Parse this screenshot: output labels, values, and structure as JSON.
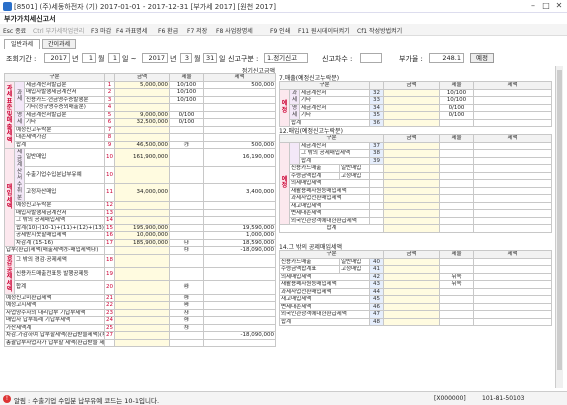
{
  "window": {
    "title": "[8501] (주)세동하전자 (기) 2017-01-01 - 2017-12-31 [부가세 2017] [원천 2017]"
  },
  "app": {
    "title": "부가가치세신고서"
  },
  "toolbar": [
    "Esc 종료",
    "Ctrl 부가세작업관리",
    "F3 마감",
    "F4 과표명세",
    "F6 환급",
    "F7 저장",
    "F8 사업장명세",
    "F9 인쇄",
    "F11 원시데이터켜기",
    "Cf1 작성방법켜기"
  ],
  "tabs": [
    "일반과세",
    "간이과세"
  ],
  "filter": {
    "label_period": "조회기간 :",
    "year1": "2017",
    "unit_year": "년",
    "month1": "1",
    "unit_month": "월",
    "day1": "1",
    "unit_day": "일 ~",
    "year2": "2017",
    "month2": "3",
    "day2": "31",
    "label_type": "신고구분 :",
    "type_val": "1.정기신고",
    "label_seq": "신고차수 :",
    "label_rate": "부가율 :",
    "rate_val": "248.1",
    "btn": "예정"
  },
  "left": {
    "period_hdr": "정기신고금액",
    "hdr": [
      "구분",
      "",
      "금액",
      "세율",
      "세액"
    ],
    "rows": [
      [
        "세금계산서발급분",
        "1",
        "5,000,000",
        "10/100",
        "500,000"
      ],
      [
        "매입자발행세금계산서",
        "2",
        "",
        "10/100",
        ""
      ],
      [
        "신용카드·현금영수증발행분",
        "3",
        "",
        "10/100",
        ""
      ],
      [
        "기타(정규영수증외매출분)",
        "4",
        "",
        "",
        ""
      ],
      [
        "세금계산서발급분",
        "5",
        "9,000,000",
        "0/100",
        ""
      ],
      [
        "기타",
        "6",
        "32,500,000",
        "0/100",
        ""
      ],
      [
        "예정신고누락분",
        "7",
        "",
        "",
        ""
      ],
      [
        "대손세액가감",
        "8",
        "",
        "",
        ""
      ],
      [
        "합계",
        "9",
        "46,500,000",
        "㉮",
        "500,000"
      ],
      [
        "일반매입",
        "10",
        "161,900,000",
        "",
        "16,190,000"
      ],
      [
        "수출기업수입분납부유예",
        "10",
        "",
        "",
        ""
      ],
      [
        "고정자산매입",
        "11",
        "34,000,000",
        "",
        "3,400,000"
      ],
      [
        "예정신고누락분",
        "12",
        "",
        "",
        ""
      ],
      [
        "매입자발행세금계산서",
        "13",
        "",
        "",
        ""
      ],
      [
        "그 밖의 공제매입세액",
        "14",
        "",
        "",
        ""
      ],
      [
        "합계(10)-(10-1)+(11)+(12)+(13)+(14)",
        "15",
        "195,900,000",
        "",
        "19,590,000"
      ],
      [
        "공제받지못할매입세액",
        "16",
        "10,000,000",
        "",
        "1,000,000"
      ],
      [
        "차감계 (15-16)",
        "17",
        "185,900,000",
        "㉯",
        "18,590,000"
      ],
      [
        "납부(환급)세액(매출세액㉮-매입세액㉯)",
        "",
        "",
        "㉰",
        "-18,090,000"
      ],
      [
        "그 밖의 경감·공제세액",
        "18",
        "",
        "",
        ""
      ],
      [
        "신용카드매출전표등 발행공제등",
        "19",
        "",
        "",
        ""
      ],
      [
        "합계",
        "20",
        "",
        "㉱",
        ""
      ],
      [
        "예정신고미환급세액",
        "21",
        "",
        "㉲",
        ""
      ],
      [
        "예정고지세액",
        "22",
        "",
        "㉳",
        ""
      ],
      [
        "사업양수자의 대리납부 기납부세액",
        "23",
        "",
        "㉴",
        ""
      ],
      [
        "매입자 납부특례 기납부세액",
        "24",
        "",
        "㉵",
        ""
      ],
      [
        "가산세액계",
        "25",
        "",
        "㉶",
        ""
      ],
      [
        "차감.가감하여 납부할세액(환급받을세액)(㉰-㉱-㉲-㉳-㉴-㉵+㉶)",
        "27",
        "",
        "",
        "-18,090,000"
      ],
      [
        "총괄납부사업자가 납부할 세액(환급받을 세액)",
        "",
        "",
        "",
        ""
      ]
    ],
    "side": {
      "tax": "과세",
      "zero": "영세",
      "sales_tax": "과세표준및매출세액",
      "purchase": "매입세액",
      "tax_invoice_recv": "세금계산서수취분",
      "reduce": "경감공제세액",
      "etc": "기타"
    }
  },
  "right": {
    "sec7": "7.매출(예정신고누락분)",
    "sec7_rows": [
      [
        "세금계산서",
        "32",
        "",
        "10/100",
        ""
      ],
      [
        "기타",
        "33",
        "",
        "10/100",
        ""
      ],
      [
        "세금계산서",
        "34",
        "",
        "0/100",
        ""
      ],
      [
        "기타",
        "35",
        "",
        "0/100",
        ""
      ],
      [
        "합계",
        "36",
        "",
        "",
        ""
      ]
    ],
    "sec12": "12.매입(예정신고누락분)",
    "sec12_rows": [
      [
        "세금계산서",
        "37",
        "",
        "",
        ""
      ],
      [
        "그 밖의 공제매입세액",
        "38",
        "",
        "",
        ""
      ],
      [
        "합계",
        "39",
        "",
        "",
        ""
      ],
      [
        "신용카드매출",
        "",
        "일반매입",
        "",
        ""
      ],
      [
        "수령금액합계",
        "",
        "고정매입",
        "",
        ""
      ],
      [
        "의제매입세액",
        "",
        "",
        "",
        ""
      ],
      [
        "재활용폐자원등매입세액",
        "",
        "",
        "",
        ""
      ],
      [
        "과세사업전환매입세액",
        "",
        "",
        "",
        ""
      ],
      [
        "재고매입세액",
        "",
        "",
        "",
        ""
      ],
      [
        "변제대손세액",
        "",
        "",
        "",
        ""
      ],
      [
        "외국인관광객에대한환급세액",
        "",
        "",
        "",
        ""
      ],
      [
        "합계",
        "",
        "",
        "",
        ""
      ]
    ],
    "sec14": "14.그 밖의 공제매입세액",
    "sec14_rows": [
      [
        "신용카드매출",
        "일반매입",
        "40",
        "",
        ""
      ],
      [
        "수령금액합계표",
        "고정매입",
        "41",
        "",
        ""
      ],
      [
        "의제매입세액",
        "",
        "42",
        "",
        "뒤쪽"
      ],
      [
        "재활용폐자원등매입세액",
        "",
        "43",
        "",
        "뒤쪽"
      ],
      [
        "과세사업전환매입세액",
        "",
        "44",
        "",
        ""
      ],
      [
        "재고매입세액",
        "",
        "45",
        "",
        ""
      ],
      [
        "변제대손세액",
        "",
        "46",
        "",
        ""
      ],
      [
        "외국인관광객에대한환급세액",
        "",
        "47",
        "",
        ""
      ],
      [
        "합계",
        "",
        "48",
        "",
        ""
      ]
    ],
    "side7": {
      "pre": "예정",
      "omit": "누락분",
      "sales": "매출"
    },
    "side12": {
      "pre": "예정",
      "omit": "누락분"
    }
  },
  "status": {
    "icon": "알림",
    "text": "알림 : 수출기업 수입분 납부유예 코드는 10-1입니다.",
    "code": "[X000000]",
    "num": "101-81-50103"
  }
}
